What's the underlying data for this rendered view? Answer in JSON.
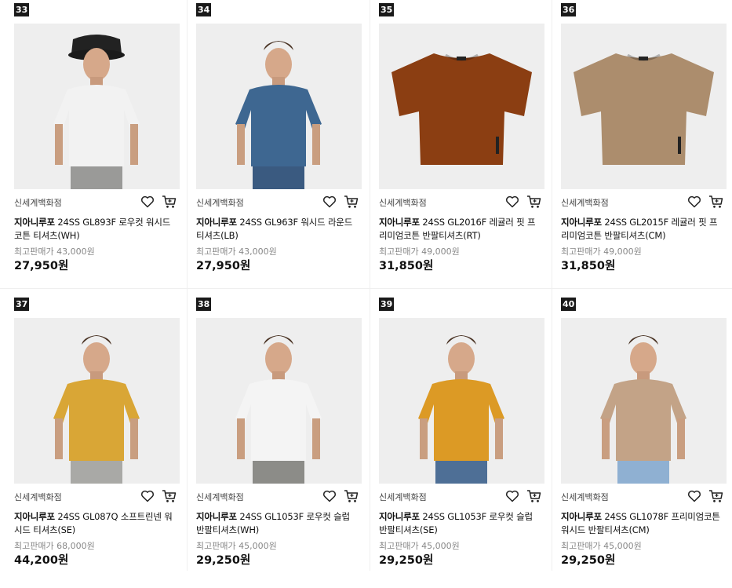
{
  "products": [
    {
      "rank": "33",
      "store": "신세계백화점",
      "brand": "지아니루포",
      "name": "24SS GL893F 로우컷 워시드코튼 티셔츠(WH)",
      "orig_price": "최고판매가 43,000원",
      "price": "27,950원",
      "shirt_color": "#f2f2f2",
      "model": "male-hat",
      "pants_color": "#9a9a98"
    },
    {
      "rank": "34",
      "store": "신세계백화점",
      "brand": "지아니루포",
      "name": "24SS GL963F 워시드 라운드 티셔츠(LB)",
      "orig_price": "최고판매가 43,000원",
      "price": "27,950원",
      "shirt_color": "#3e6791",
      "model": "male",
      "pants_color": "#3a5a80"
    },
    {
      "rank": "35",
      "store": "신세계백화점",
      "brand": "지아니루포",
      "name": "24SS GL2016F 레귤러 핏 프리미엄코튼 반팔티셔츠(RT)",
      "orig_price": "최고판매가 49,000원",
      "price": "31,850원",
      "shirt_color": "#8b3e12",
      "model": "flat",
      "pants_color": ""
    },
    {
      "rank": "36",
      "store": "신세계백화점",
      "brand": "지아니루포",
      "name": "24SS GL2015F 레귤러 핏 프리미엄코튼 반팔티셔츠(CM)",
      "orig_price": "최고판매가 49,000원",
      "price": "31,850원",
      "shirt_color": "#ac8d6d",
      "model": "flat",
      "pants_color": ""
    },
    {
      "rank": "37",
      "store": "신세계백화점",
      "brand": "지아니루포",
      "name": "24SS GL087Q 소프트린넨 워시드 티셔츠(SE)",
      "orig_price": "최고판매가 68,000원",
      "price": "44,200원",
      "shirt_color": "#d9a636",
      "model": "male",
      "pants_color": "#a9a9a6"
    },
    {
      "rank": "38",
      "store": "신세계백화점",
      "brand": "지아니루포",
      "name": "24SS GL1053F 로우컷 슬럽 반팔티셔츠(WH)",
      "orig_price": "최고판매가 45,000원",
      "price": "29,250원",
      "shirt_color": "#f4f4f4",
      "model": "male",
      "pants_color": "#8c8c88"
    },
    {
      "rank": "39",
      "store": "신세계백화점",
      "brand": "지아니루포",
      "name": "24SS GL1053F 로우컷 슬럽 반팔티셔츠(SE)",
      "orig_price": "최고판매가 45,000원",
      "price": "29,250원",
      "shirt_color": "#dc9a25",
      "model": "male",
      "pants_color": "#4e6f96"
    },
    {
      "rank": "40",
      "store": "신세계백화점",
      "brand": "지아니루포",
      "name": "24SS GL1078F 프리미엄코튼 워시드 반팔티셔츠(CM)",
      "orig_price": "최고판매가 45,000원",
      "price": "29,250원",
      "shirt_color": "#c3a387",
      "model": "male",
      "pants_color": "#8fb0d2"
    }
  ]
}
